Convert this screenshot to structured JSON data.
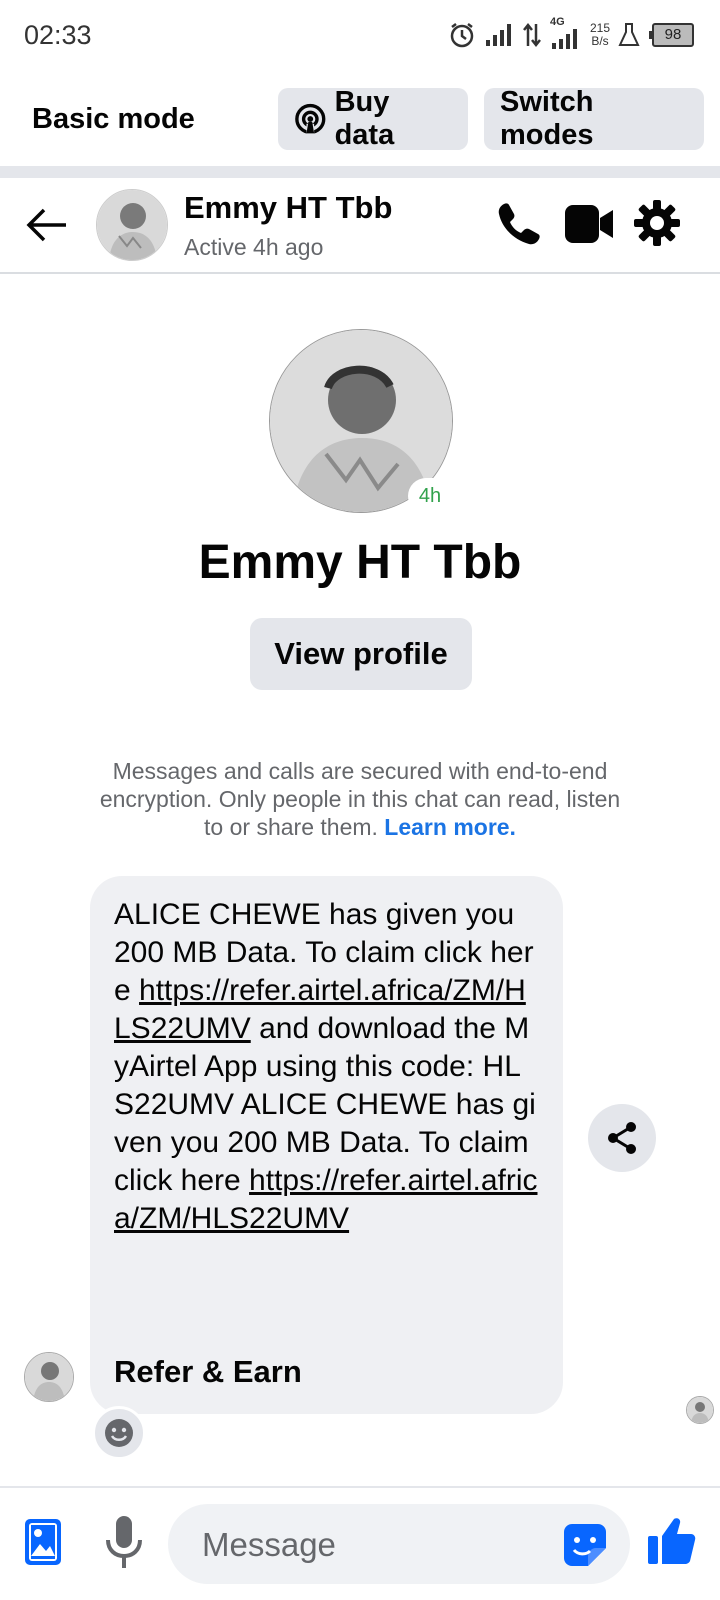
{
  "status_bar": {
    "time": "02:33",
    "network": "4G",
    "speed_value": "215",
    "speed_unit": "B/s",
    "battery": "98"
  },
  "mode_bar": {
    "title": "Basic mode",
    "buy_data_label": "Buy data",
    "switch_modes_label": "Switch modes"
  },
  "chat_header": {
    "name": "Emmy HT Tbb",
    "status": "Active 4h ago"
  },
  "profile": {
    "active_badge": "4h",
    "name": "Emmy HT Tbb",
    "view_profile_label": "View profile"
  },
  "encryption_notice": {
    "text": "Messages and calls are secured with end-to-end encryption. Only people in this chat can read, listen to or share them. ",
    "learn_more": "Learn more."
  },
  "message": {
    "part1": "ALICE  CHEWE has given you 200 MB Data. To claim click here ",
    "link1": "https://refer.airtel.africa/ZM/HLS22UMV",
    "part2": " and download the MyAirtel App using this code: HLS22UMV ALICE  CHEWE has given you 200 MB Data. To claim click here ",
    "link2": "https://refer.airtel.africa/ZM/HLS22UMV",
    "title": "Refer & Earn"
  },
  "composer": {
    "placeholder": "Message"
  },
  "colors": {
    "accent": "#0866ff",
    "bubble": "#eff0f3",
    "pill": "#e4e6eb",
    "active_green": "#31a24c",
    "link_blue": "#1b74e4"
  }
}
